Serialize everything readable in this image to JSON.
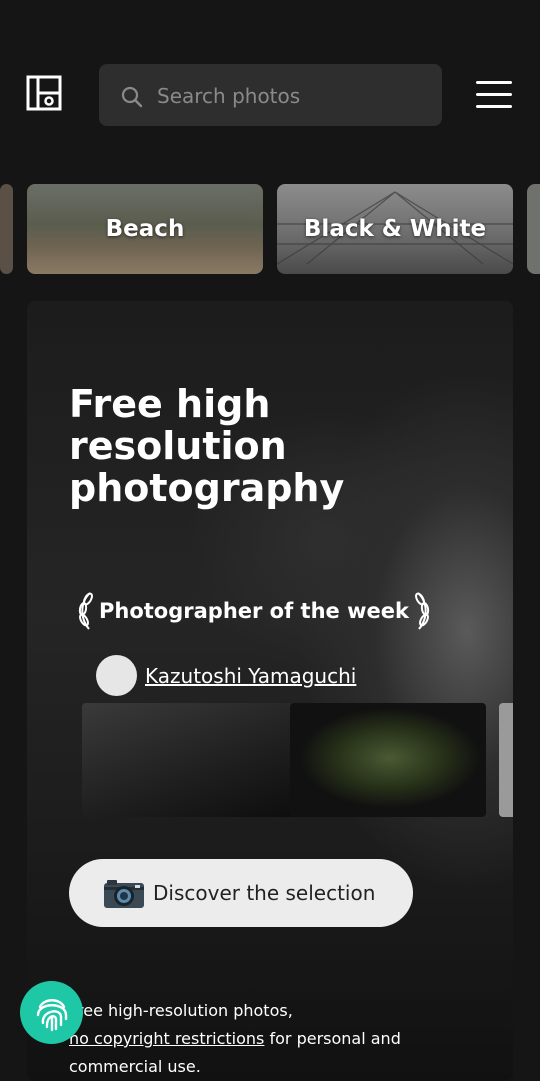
{
  "header": {
    "search_placeholder": "Search photos"
  },
  "categories": [
    {
      "label": "Beach"
    },
    {
      "label": "Black & White"
    }
  ],
  "hero": {
    "title": "Free high resolution photography",
    "photographer_heading": "Photographer of the week",
    "photographer_name": "Kazutoshi Yamaguchi",
    "cta_label": "Discover the selection",
    "cta_icon": "camera-icon",
    "footer_text_prefix": "Free high-resolution photos,",
    "footer_link": "no copyright restrictions",
    "footer_text_suffix": " for personal and commercial use."
  },
  "colors": {
    "background": "#151515",
    "accent_fab": "#1ec8a6",
    "cta_bg": "#ececec"
  }
}
